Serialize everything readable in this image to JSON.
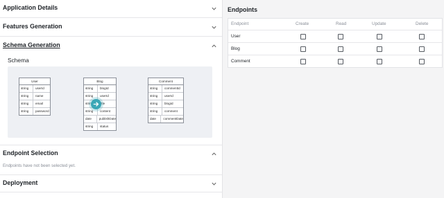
{
  "accordion": {
    "application_details": "Application Details",
    "features_generation": "Features Generation",
    "schema_generation": "Schema Generation",
    "endpoint_selection": "Endpoint Selection",
    "deployment": "Deployment"
  },
  "schema": {
    "label": "Schema",
    "entities": {
      "user": {
        "name": "User",
        "fields": [
          {
            "type": "string",
            "name": "userId"
          },
          {
            "type": "string",
            "name": "name"
          },
          {
            "type": "string",
            "name": "email"
          },
          {
            "type": "string",
            "name": "password"
          }
        ]
      },
      "blog": {
        "name": "Blog",
        "fields": [
          {
            "type": "string",
            "name": "blogId"
          },
          {
            "type": "string",
            "name": "userId"
          },
          {
            "type": "string",
            "name": "title"
          },
          {
            "type": "string",
            "name": "content"
          },
          {
            "type": "date",
            "name": "publishDate"
          },
          {
            "type": "string",
            "name": "status"
          }
        ]
      },
      "comment": {
        "name": "Comment",
        "fields": [
          {
            "type": "string",
            "name": "commentId"
          },
          {
            "type": "string",
            "name": "userId"
          },
          {
            "type": "string",
            "name": "blogId"
          },
          {
            "type": "string",
            "name": "comment"
          },
          {
            "type": "date",
            "name": "commentDate"
          }
        ]
      }
    }
  },
  "endpoint_selection": {
    "empty_message": "Endpoints have not been selected yet."
  },
  "endpoints": {
    "title": "Endpoints",
    "columns": {
      "endpoint": "Endpoint",
      "create": "Create",
      "read": "Read",
      "update": "Update",
      "delete": "Delete"
    },
    "rows": [
      {
        "name": "User",
        "create": false,
        "read": false,
        "update": false,
        "delete": false
      },
      {
        "name": "Blog",
        "create": false,
        "read": false,
        "update": false,
        "delete": false
      },
      {
        "name": "Comment",
        "create": false,
        "read": false,
        "update": false,
        "delete": false
      }
    ]
  },
  "icons": {
    "chevron_down": "chevron-down-icon",
    "chevron_up": "chevron-up-icon",
    "cursor": "arrow-right-icon"
  },
  "colors": {
    "cursor_accent": "#3aa7b6",
    "panel_background": "#f4f4f5",
    "muted_text": "#8a8f98"
  }
}
